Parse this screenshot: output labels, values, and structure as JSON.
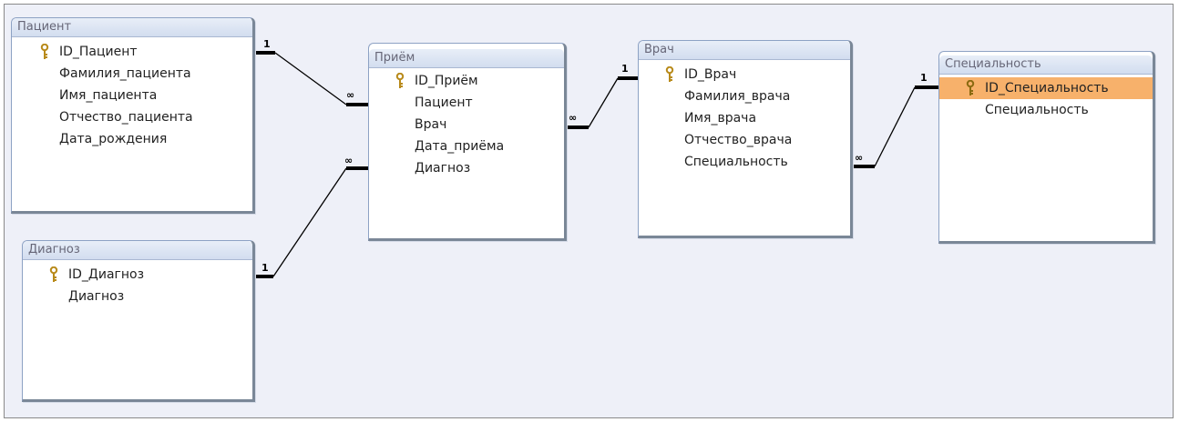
{
  "tables": {
    "patient": {
      "title": "Пациент",
      "fields": [
        "ID_Пациент",
        "Фамилия_пациента",
        "Имя_пациента",
        "Отчество_пациента",
        "Дата_рождения"
      ]
    },
    "diagnosis": {
      "title": "Диагноз",
      "fields": [
        "ID_Диагноз",
        "Диагноз"
      ]
    },
    "reception": {
      "title": "Приём",
      "fields": [
        "ID_Приём",
        "Пациент",
        "Врач",
        "Дата_приёма",
        "Диагноз"
      ]
    },
    "doctor": {
      "title": "Врач",
      "fields": [
        "ID_Врач",
        "Фамилия_врача",
        "Имя_врача",
        "Отчество_врача",
        "Специальность"
      ]
    },
    "specialty": {
      "title": "Специальность",
      "fields": [
        "ID_Специальность",
        "Специальность"
      ]
    }
  },
  "relationships": [
    {
      "from": "patient",
      "to": "reception",
      "one": "1",
      "many": "∞"
    },
    {
      "from": "diagnosis",
      "to": "reception",
      "one": "1",
      "many": "∞"
    },
    {
      "from": "doctor",
      "to": "reception",
      "one": "1",
      "many": "∞"
    },
    {
      "from": "specialty",
      "to": "doctor",
      "one": "1",
      "many": "∞"
    }
  ],
  "colors": {
    "highlight": "#f7b16b",
    "title_bar": "#d2ddef",
    "canvas": "#eef0f8"
  }
}
